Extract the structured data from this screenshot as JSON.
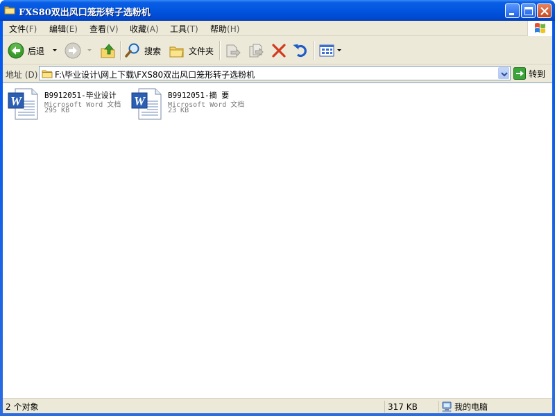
{
  "window": {
    "title": "FXS80双出风口笼形转子选粉机"
  },
  "menu": [
    {
      "label": "文件",
      "key": "(F)"
    },
    {
      "label": "编辑",
      "key": "(E)"
    },
    {
      "label": "查看",
      "key": "(V)"
    },
    {
      "label": "收藏",
      "key": "(A)"
    },
    {
      "label": "工具",
      "key": "(T)"
    },
    {
      "label": "帮助",
      "key": "(H)"
    }
  ],
  "toolbar": {
    "back_label": "后退",
    "search_label": "搜索",
    "folders_label": "文件夹"
  },
  "address": {
    "label": "地址",
    "key": "(D)",
    "path": "F:\\毕业设计\\网上下载\\FXS80双出风口笼形转子选粉机",
    "go_label": "转到"
  },
  "files": [
    {
      "name": "B9912051-毕业设计",
      "type": "Microsoft Word 文档",
      "size": "295 KB",
      "icon": "word-document-icon"
    },
    {
      "name": "B9912051-摘 要",
      "type": "Microsoft Word 文档",
      "size": "23 KB",
      "icon": "word-document-icon"
    }
  ],
  "status": {
    "count": "2 个对象",
    "size": "317 KB",
    "location": "我的电脑"
  },
  "colors": {
    "titlebar": "#0255e0",
    "chrome": "#ece9d8",
    "word_blue": "#2b5fb4"
  }
}
